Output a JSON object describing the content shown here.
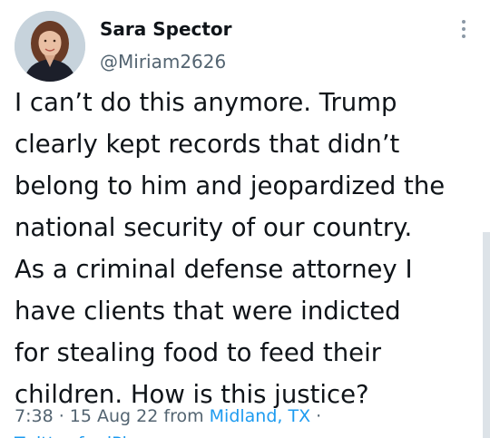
{
  "author": {
    "display_name": "Sara Spector",
    "handle": "@Miriam2626"
  },
  "tweet": {
    "text": "I can’t do this anymore. Trump\nclearly kept records that didn’t\nbelong to him and jeopardized the\nnational security of our country.\nAs a criminal defense attorney I\nhave clients that were indicted\nfor stealing food to feed their\nchildren. How is this justice?",
    "time": "7:38",
    "sep1": " · ",
    "date": "15 Aug 22",
    "from_label": " from ",
    "location": "Midland, TX",
    "sep2": " ·",
    "source_partial": "Twitter for iPhone"
  },
  "icons": {
    "more": "more-vertical-icon",
    "avatar": "profile-photo"
  },
  "colors": {
    "text": "#0f1419",
    "secondary": "#536471",
    "link": "#1d9bf0"
  }
}
